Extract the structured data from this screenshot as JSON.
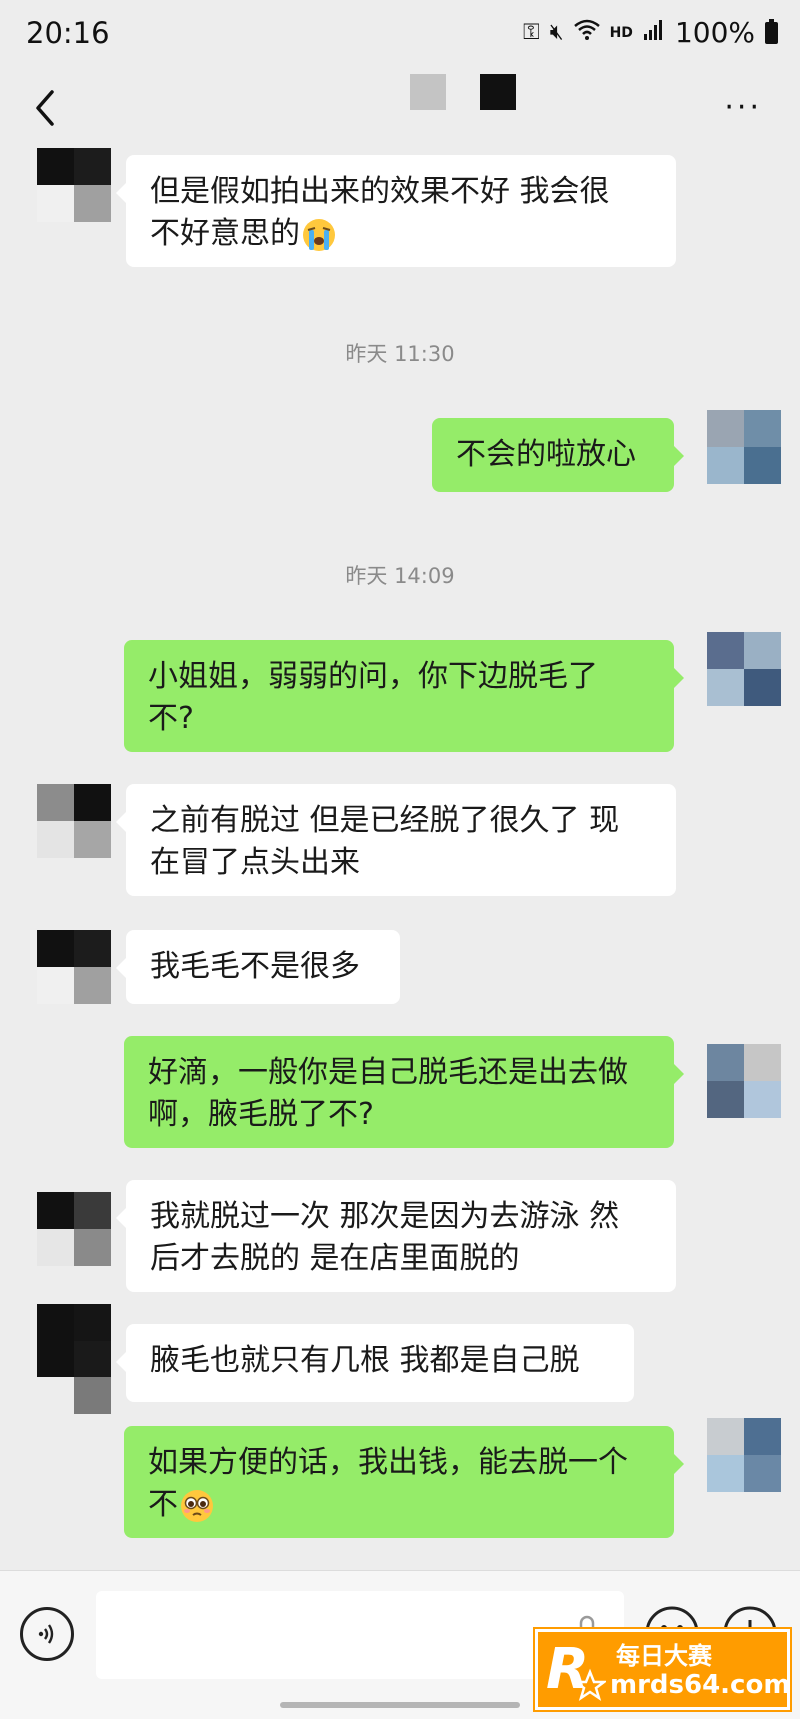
{
  "status_bar": {
    "time": "20:16",
    "hd": "HD",
    "battery": "100%",
    "icons": [
      "key-icon",
      "mute-icon",
      "wifi-icon",
      "signal-icon",
      "battery-icon"
    ]
  },
  "nav": {
    "back_icon": "chevron-left-icon",
    "more_label": "···"
  },
  "messages": [
    {
      "side": "left",
      "text": "但是假如拍出来的效果不好 我会很",
      "text2": "不好意思的",
      "emoji": "crying-face"
    },
    {
      "type": "timestamp",
      "text": "昨天 11:30"
    },
    {
      "side": "right",
      "text": "不会的啦放心"
    },
    {
      "type": "timestamp",
      "text": "昨天 14:09"
    },
    {
      "side": "right",
      "text": "小姐姐，弱弱的问，你下边脱毛了",
      "text2": "不?"
    },
    {
      "side": "left",
      "text": "之前有脱过 但是已经脱了很久了 现",
      "text2": "在冒了点头出来"
    },
    {
      "side": "left",
      "text": "我毛毛不是很多"
    },
    {
      "side": "right",
      "text": "好滴，一般你是自己脱毛还是出去做",
      "text2": "啊，腋毛脱了不?"
    },
    {
      "side": "left",
      "text": "我就脱过一次 那次是因为去游泳 然",
      "text2": "后才去脱的 是在店里面脱的"
    },
    {
      "side": "left",
      "text": "腋毛也就只有几根 我都是自己脱"
    },
    {
      "side": "right",
      "text": "如果方便的话，我出钱，能去脱一个",
      "text2": "不",
      "emoji": "pleading-face"
    }
  ],
  "input_bar": {
    "icons": [
      "voice-icon",
      "mic-icon",
      "smile-icon",
      "plus-icon"
    ]
  },
  "watermark": {
    "logo_letter": "R",
    "title": "每日大赛",
    "url": "mrds64.com"
  },
  "colors": {
    "background": "#ededed",
    "bubble_sent": "#95ec69",
    "bubble_received": "#ffffff",
    "watermark": "#ff9c00"
  }
}
